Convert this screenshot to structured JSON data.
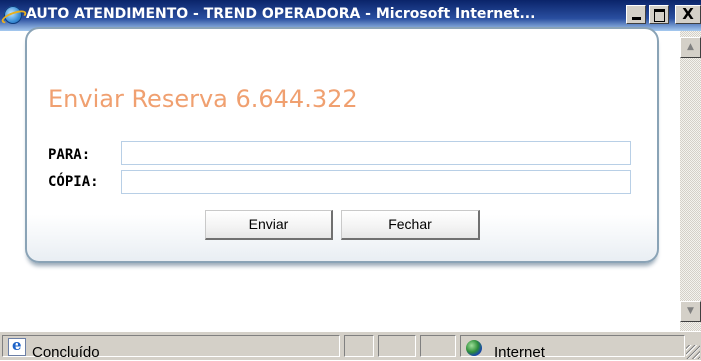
{
  "window": {
    "title": "AUTO ATENDIMENTO - TREND OPERADORA - Microsoft Internet...",
    "minimize_label": "_",
    "close_label": "X"
  },
  "card": {
    "title": "Enviar Reserva 6.644.322"
  },
  "form": {
    "para": {
      "label": "PARA:",
      "value": "",
      "placeholder": ""
    },
    "copia": {
      "label": "CÓPIA:",
      "value": "",
      "placeholder": ""
    }
  },
  "buttons": {
    "send_label": "Enviar",
    "close_label": "Fechar"
  },
  "statusbar": {
    "status_text": "Concluído",
    "zone_text": "Internet"
  },
  "icons": {
    "app": "ie-logo-icon",
    "page": "ie-page-icon",
    "zone": "globe-icon"
  }
}
